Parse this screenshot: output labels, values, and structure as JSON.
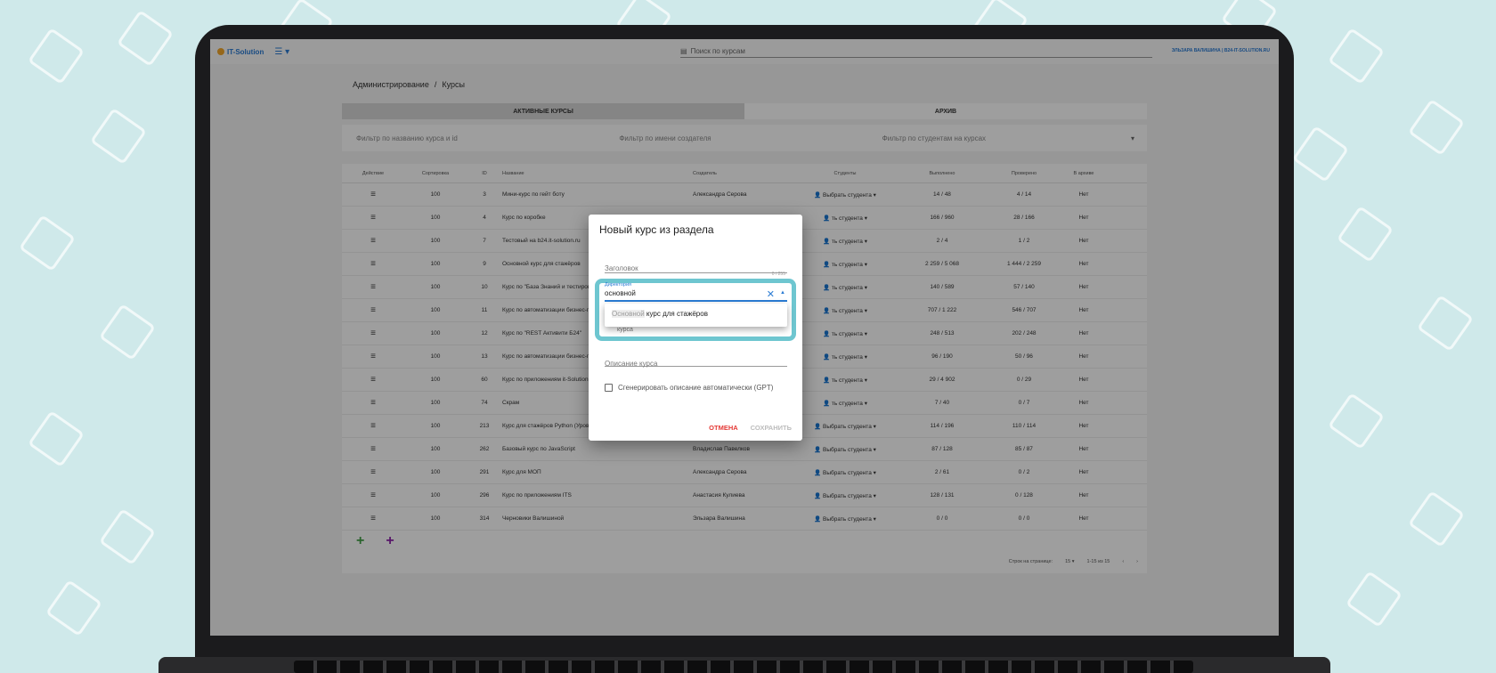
{
  "app": {
    "logo_text": "IT-Solution",
    "search_placeholder": "Поиск по курсам",
    "user": "ЭЛЬЗАРА ВАЛИШИНА | B24-IT-SOLUTION.RU"
  },
  "breadcrumb": [
    "Администрирование",
    "/",
    "Курсы"
  ],
  "tabs": [
    {
      "label": "АКТИВНЫЕ КУРСЫ",
      "active": true
    },
    {
      "label": "АРХИВ",
      "active": false
    }
  ],
  "filters": {
    "name": "Фильтр по названию курса и id",
    "creator": "Фильтр по имени создателя",
    "students": "Фильтр по студентам на курсах"
  },
  "table": {
    "headers": [
      "Действие",
      "Сортировка",
      "ID",
      "Название",
      "Создатель",
      "Студенты",
      "Выполнено",
      "Проверено",
      "В архиве"
    ],
    "student_placeholder": "Выбрать студента",
    "rows": [
      {
        "sort": "100",
        "id": "3",
        "name": "Мини-курс по гейт боту",
        "creator": "Александра Серова",
        "students": "Выбрать студента",
        "done": "14 / 48",
        "checked": "4 / 14",
        "archived": "Нет"
      },
      {
        "sort": "100",
        "id": "4",
        "name": "Курс по коробке",
        "creator": "",
        "students": "ть студента",
        "done": "166 / 960",
        "checked": "28 / 166",
        "archived": "Нет"
      },
      {
        "sort": "100",
        "id": "7",
        "name": "Тестовый на b24.it-solution.ru",
        "creator": "",
        "students": "ть студента",
        "done": "2 / 4",
        "checked": "1 / 2",
        "archived": "Нет"
      },
      {
        "sort": "100",
        "id": "9",
        "name": "Основной курс для стажёров",
        "creator": "",
        "students": "ть студента",
        "done": "2 259 / 5 068",
        "checked": "1 444 / 2 259",
        "archived": "Нет"
      },
      {
        "sort": "100",
        "id": "10",
        "name": "Курс по \"База Знаний и тестирование\"",
        "creator": "",
        "students": "ть студента",
        "done": "140 / 589",
        "checked": "57 / 140",
        "archived": "Нет"
      },
      {
        "sort": "100",
        "id": "11",
        "name": "Курс по автоматизации бизнес-процес",
        "creator": "",
        "students": "ть студента",
        "done": "707 / 1 222",
        "checked": "546 / 707",
        "archived": "Нет"
      },
      {
        "sort": "100",
        "id": "12",
        "name": "Курс по \"REST Активити Б24\"",
        "creator": "",
        "students": "ть студента",
        "done": "248 / 513",
        "checked": "202 / 248",
        "archived": "Нет"
      },
      {
        "sort": "100",
        "id": "13",
        "name": "Курс по автоматизации бизнес-процес",
        "creator": "",
        "students": "ть студента",
        "done": "96 / 190",
        "checked": "50 / 96",
        "archived": "Нет"
      },
      {
        "sort": "100",
        "id": "60",
        "name": "Курс по приложениям it-Solution",
        "creator": "",
        "students": "ть студента",
        "done": "29 / 4 902",
        "checked": "0 / 29",
        "archived": "Нет"
      },
      {
        "sort": "100",
        "id": "74",
        "name": "Скрам",
        "creator": "",
        "students": "ть студента",
        "done": "7 / 40",
        "checked": "0 / 7",
        "archived": "Нет"
      },
      {
        "sort": "100",
        "id": "213",
        "name": "Курс для стажёров Python (Уровень 1)",
        "creator": "",
        "students": "Выбрать студента",
        "done": "114 / 196",
        "checked": "110 / 114",
        "archived": "Нет"
      },
      {
        "sort": "100",
        "id": "262",
        "name": "Базовый курс по JavaScript",
        "creator": "Владислав Павелков",
        "students": "Выбрать студента",
        "done": "87 / 128",
        "checked": "85 / 87",
        "archived": "Нет"
      },
      {
        "sort": "100",
        "id": "291",
        "name": "Курс для МОП",
        "creator": "Александра Серова",
        "students": "Выбрать студента",
        "done": "2 / 61",
        "checked": "0 / 2",
        "archived": "Нет"
      },
      {
        "sort": "100",
        "id": "296",
        "name": "Курс по приложениям ITS",
        "creator": "Анастасия Кулиева",
        "students": "Выбрать студента",
        "done": "128 / 131",
        "checked": "0 / 128",
        "archived": "Нет"
      },
      {
        "sort": "100",
        "id": "314",
        "name": "Черновики Валишиной",
        "creator": "Эльзара Валишина",
        "students": "Выбрать студента",
        "done": "0 / 0",
        "checked": "0 / 0",
        "archived": "Нет"
      }
    ]
  },
  "pager": {
    "rows_label": "Строк на странице:",
    "rows_value": "15",
    "range": "1-15 из 15"
  },
  "dialog": {
    "title": "Новый курс из раздела",
    "title_field_label": "Заголовок",
    "title_counter": "0 / 255",
    "directory_label": "Директория",
    "directory_value": "основной",
    "option_match": "Основной",
    "option_rest": " курс для стажёров",
    "behind_text": "курса",
    "description_label": "Описание курса",
    "gpt_checkbox_label": "Сгенерировать описание автоматически (GPT)",
    "cancel": "ОТМЕНА",
    "save": "СОХРАНИТЬ"
  },
  "colors": {
    "accent": "#2a7bd3",
    "highlight": "#6ec6d0",
    "cancel": "#e53935",
    "add_green": "#43a047",
    "add_purple": "#8e24aa"
  }
}
